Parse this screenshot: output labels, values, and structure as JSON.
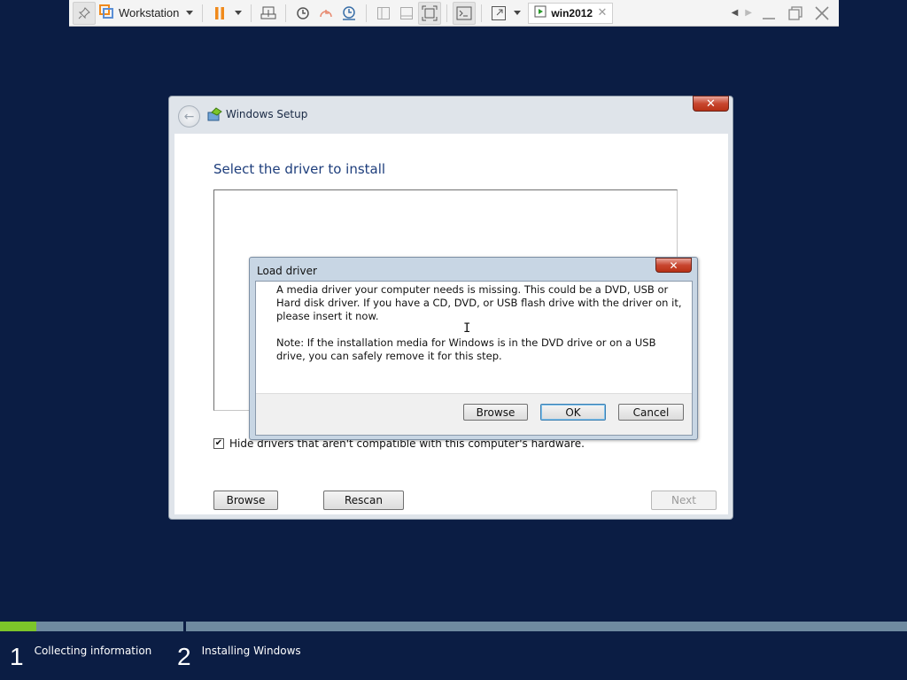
{
  "vmware": {
    "menu_label": "Workstation",
    "vm_tab_label": "win2012"
  },
  "setup": {
    "window_title": "Windows Setup",
    "heading": "Select the driver to install",
    "hide_checkbox_label": "Hide drivers that aren't compatible with this computer's hardware.",
    "hide_checked": true,
    "browse_label": "Browse",
    "rescan_label": "Rescan",
    "next_label": "Next"
  },
  "load_driver": {
    "title": "Load driver",
    "message": "A media driver your computer needs is missing. This could be a DVD, USB or Hard disk driver. If you have a CD, DVD, or USB flash drive with the driver on it, please insert it now.",
    "note": "Note: If the installation media for Windows is in the DVD drive or on a USB drive, you can safely remove it for this step.",
    "browse_label": "Browse",
    "ok_label": "OK",
    "cancel_label": "Cancel"
  },
  "progress": {
    "step1_fraction": 0.2,
    "steps": [
      {
        "number": "1",
        "label": "Collecting information"
      },
      {
        "number": "2",
        "label": "Installing Windows"
      }
    ]
  },
  "colors": {
    "desktop": "#0b1d44",
    "heading": "#1e3e7c",
    "progress_fill": "#7cc52a",
    "close_red": "#c8462f"
  }
}
